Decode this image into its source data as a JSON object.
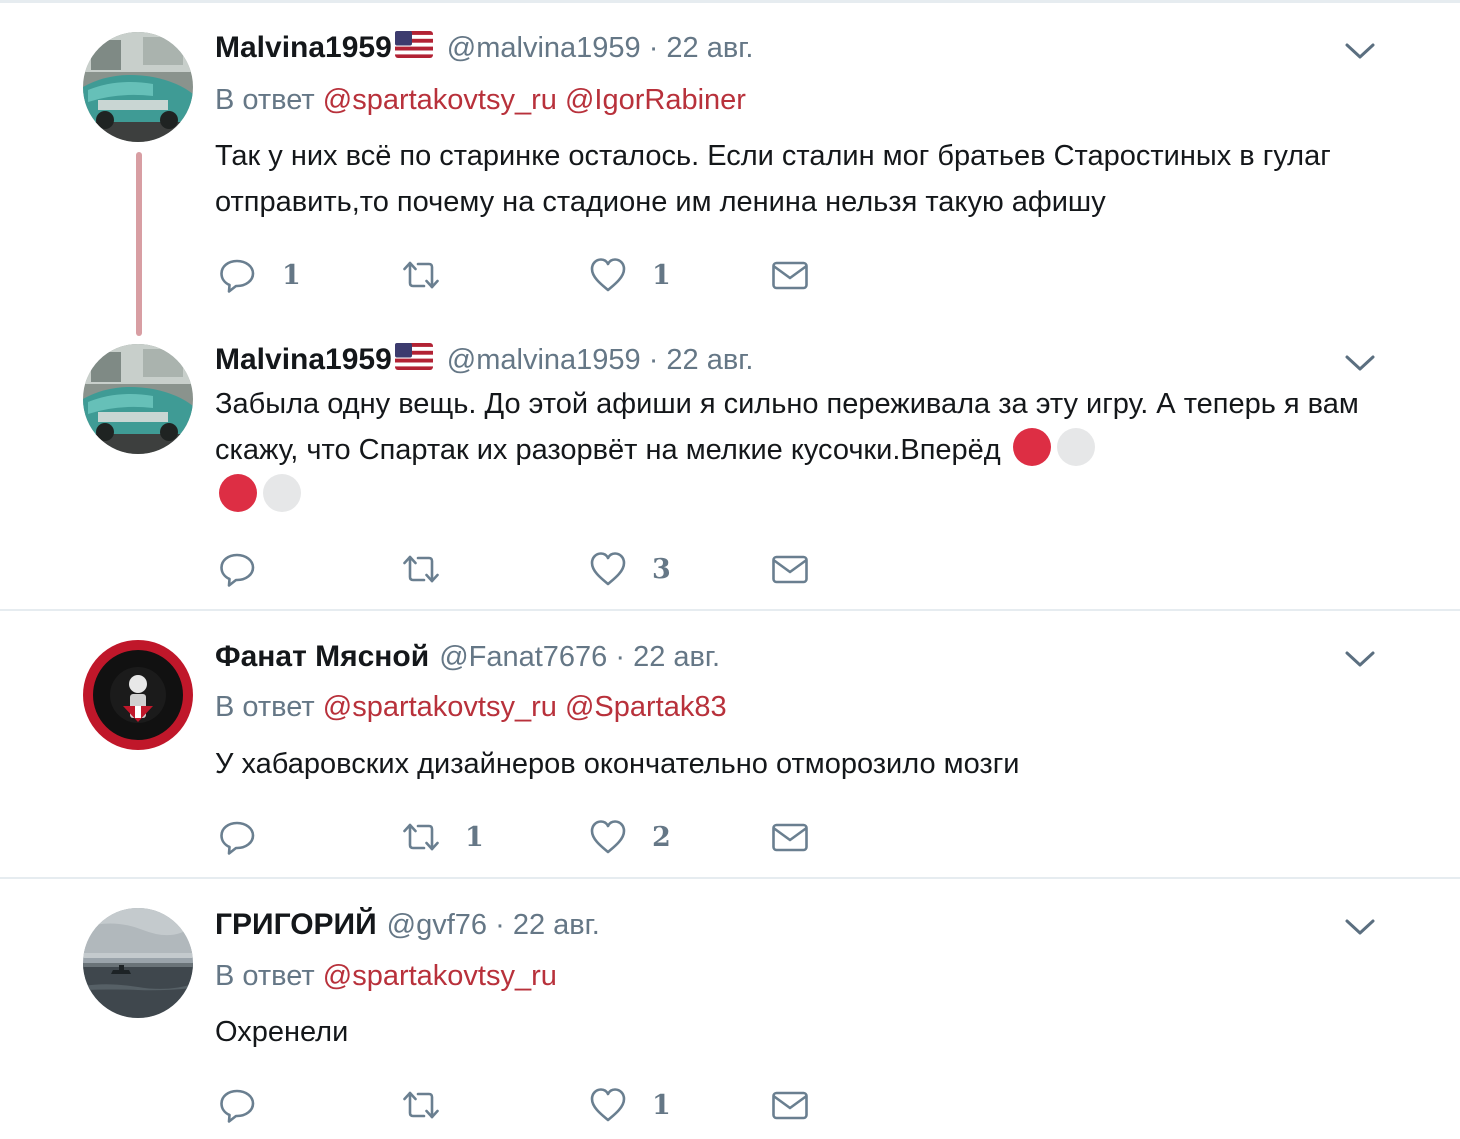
{
  "colors": {
    "accent": "#b8313b",
    "muted": "#657786",
    "text": "#14171a",
    "thread_line": "#d89ea3"
  },
  "icons": {
    "reply": "speech-bubble-icon",
    "retweet": "retweet-icon",
    "like": "heart-icon",
    "dm": "envelope-icon",
    "menu": "chevron-down-icon",
    "flag": "us-flag-icon"
  },
  "tweets": [
    {
      "name": "Malvina1959",
      "handle_date": "@malvina1959 · 22 авг.",
      "reply_prefix": "В ответ",
      "mentions": [
        "@spartakovtsy_ru",
        "@IgorRabiner"
      ],
      "text": "Так у них всё по старинке осталось. Если сталин мог братьев Старостиных в гулаг отправить,то почему на стадионе им ленина нельзя такую афишу",
      "reply_count": "1",
      "retweet_count": "",
      "like_count": "1"
    },
    {
      "name": "Malvina1959",
      "handle_date": "@malvina1959 · 22 авг.",
      "text": "Забыла одну вещь. До этой афиши я сильно переживала за эту игру. А теперь я вам скажу, что Спартак их разорвёт на мелкие кусочки.Вперёд",
      "reply_count": "",
      "retweet_count": "",
      "like_count": "3"
    },
    {
      "name": "Фанат Мясной",
      "handle_date": "@Fanat7676 · 22 авг.",
      "reply_prefix": "В ответ",
      "mentions": [
        "@spartakovtsy_ru",
        "@Spartak83"
      ],
      "text": "У хабаровских дизайнеров окончательно отморозило мозги",
      "reply_count": "",
      "retweet_count": "1",
      "like_count": "2"
    },
    {
      "name": "ГРИГОРИЙ",
      "handle_date": "@gvf76 · 22 авг.",
      "reply_prefix": "В ответ",
      "mentions": [
        "@spartakovtsy_ru"
      ],
      "text": "Охренели",
      "reply_count": "",
      "retweet_count": "",
      "like_count": "1"
    }
  ]
}
